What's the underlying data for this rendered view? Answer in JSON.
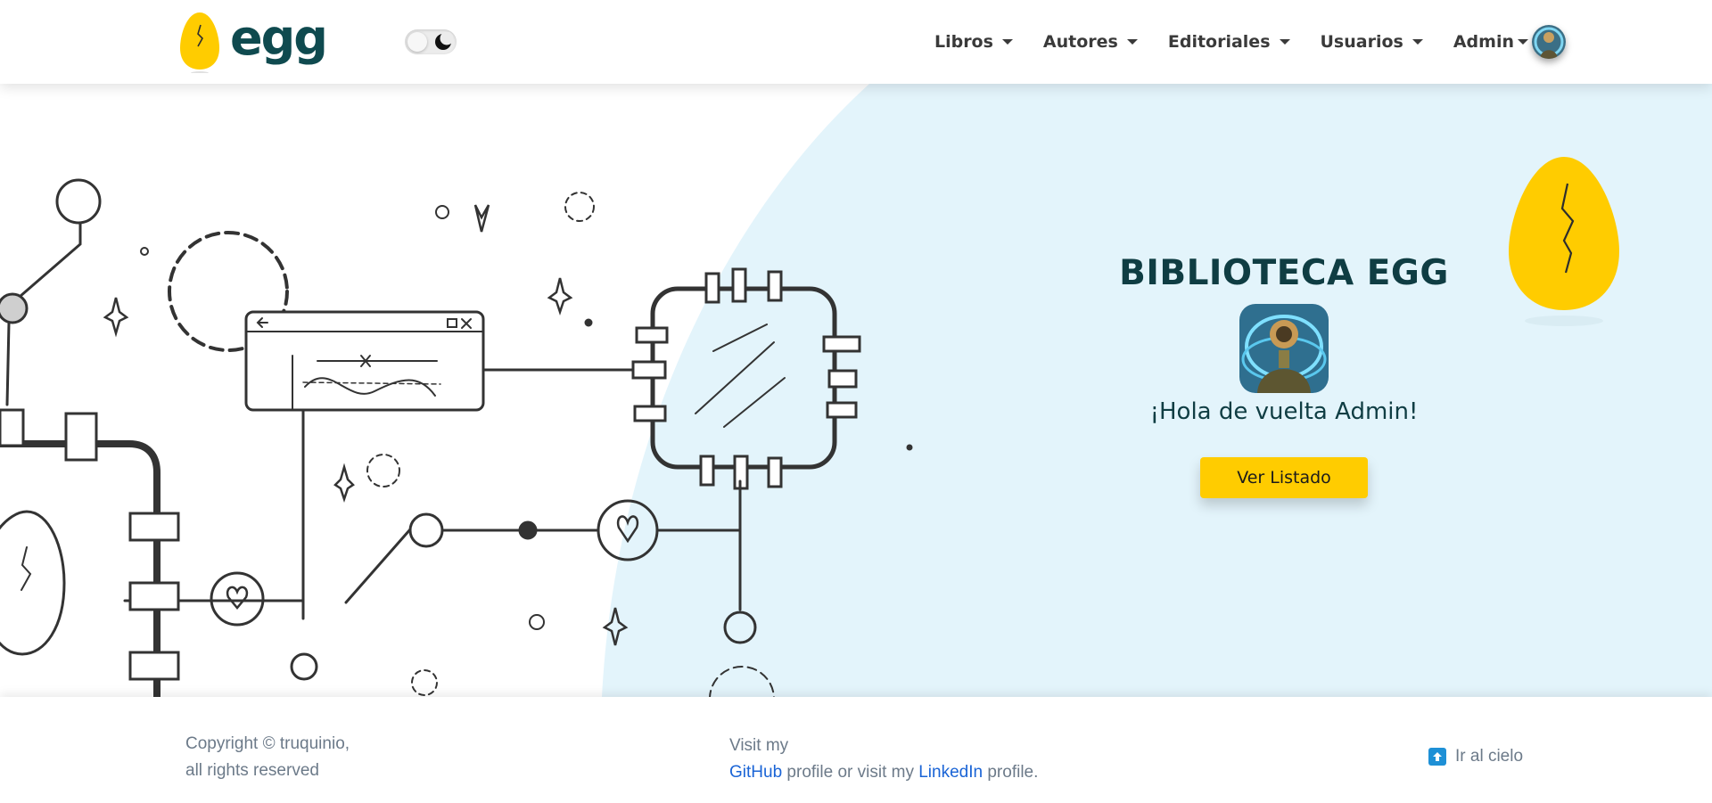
{
  "navbar": {
    "brand": "egg",
    "menu": [
      {
        "label": "Libros"
      },
      {
        "label": "Autores"
      },
      {
        "label": "Editoriales"
      },
      {
        "label": "Usuarios"
      }
    ],
    "user_menu": {
      "label": "Admin"
    }
  },
  "hero": {
    "title": "BIBLIOTECA EGG",
    "greeting": "¡Hola de vuelta Admin!",
    "cta_label": "Ver Listado"
  },
  "footer": {
    "copyright_line1": "Copyright © truquinio,",
    "copyright_line2": "all rights reserved",
    "visit_text": "Visit my",
    "github_label": "GitHub",
    "middle_text": " profile or visit my ",
    "linkedin_label": "LinkedIn",
    "end_text": " profile.",
    "back_to_top": "Ir al cielo"
  },
  "colors": {
    "brand_yellow": "#ffcc00",
    "brand_dark": "#0f4a4f",
    "hero_blue": "#e3f4fb",
    "link_blue": "#1a64d6"
  },
  "icons": [
    "egg-logo-icon",
    "moon-icon",
    "avatar",
    "arrow-up-icon"
  ]
}
